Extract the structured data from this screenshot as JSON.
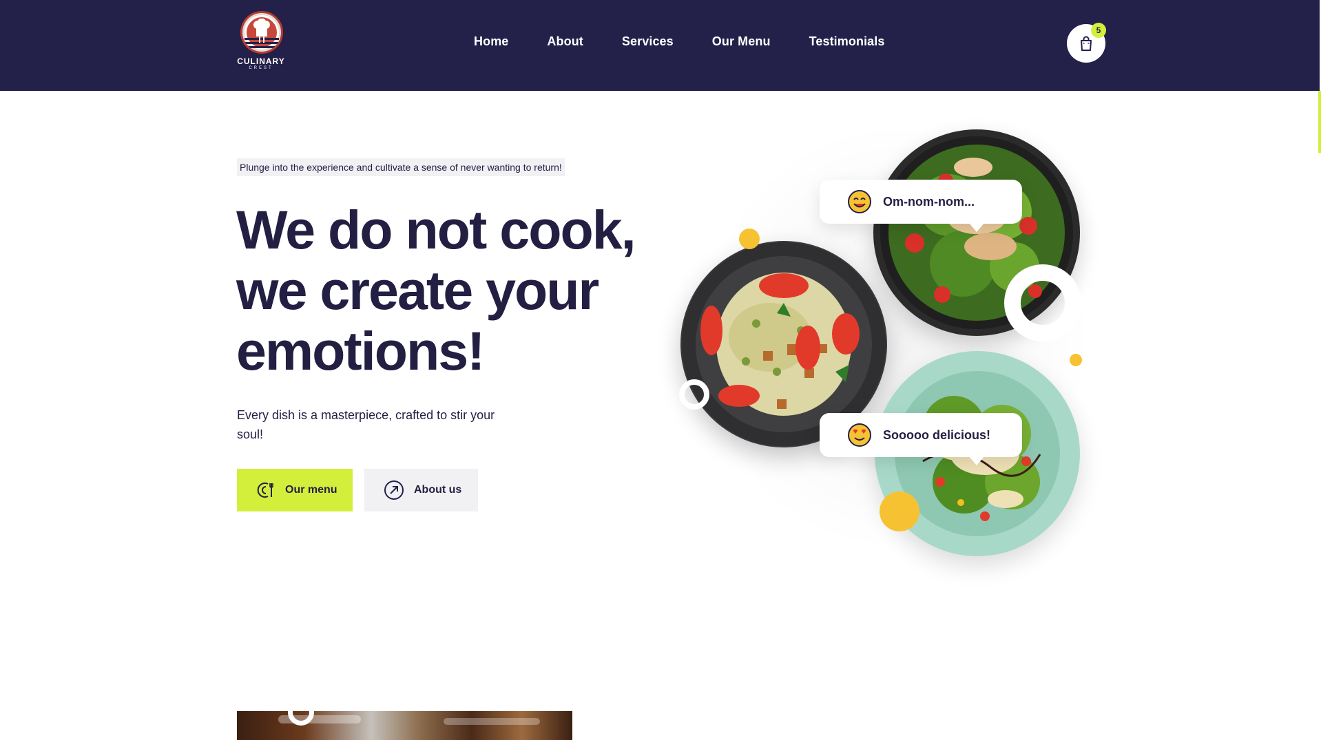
{
  "brand": {
    "name": "CULINARY",
    "subname": "CREST"
  },
  "nav": {
    "items": [
      "Home",
      "About",
      "Services",
      "Our Menu",
      "Testimonials"
    ]
  },
  "cart": {
    "icon": "shopping-bag-icon",
    "count": "5"
  },
  "hero": {
    "tagline": "Plunge into the experience and cultivate a sense of never wanting to return!",
    "headline_line1": "We do not cook,",
    "headline_line2": "we create your",
    "headline_line3": "emotions!",
    "subtext": "Every dish is a masterpiece, crafted to stir your soul!",
    "btn_menu": "Our menu",
    "btn_about": "About us"
  },
  "bubbles": {
    "first": "Om-nom-nom...",
    "second": "Sooooo delicious!"
  },
  "colors": {
    "navy": "#23204a",
    "lime": "#d3ef3b",
    "yellow": "#f7c232",
    "light_gray": "#f1f1f4",
    "mint_plate": "#a8d9c8"
  }
}
